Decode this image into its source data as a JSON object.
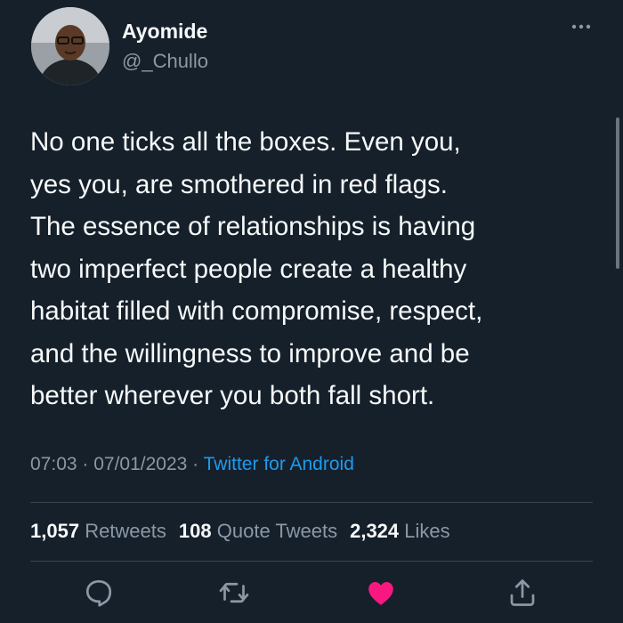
{
  "author": {
    "name": "Ayomide",
    "handle": "@_Chullo"
  },
  "tweet": {
    "text": "No one ticks all the boxes. Even you,\nyes you, are smothered in red flags.\nThe essence of relationships is having\ntwo imperfect people create a healthy\nhabitat filled with compromise, respect,\nand the willingness to improve and be\nbetter wherever you both fall short."
  },
  "meta": {
    "time": "07:03",
    "date": "07/01/2023",
    "separator": " · ",
    "source": "Twitter for Android"
  },
  "stats": {
    "retweets_count": "1,057",
    "retweets_label": "Retweets",
    "quotes_count": "108",
    "quotes_label": "Quote Tweets",
    "likes_count": "2,324",
    "likes_label": "Likes"
  },
  "actions": {
    "reply_icon": "reply-icon",
    "retweet_icon": "retweet-icon",
    "like_icon": "heart-icon",
    "share_icon": "share-icon",
    "like_active": true
  },
  "colors": {
    "background": "#15202b",
    "text": "#f7f9f9",
    "secondary_text": "#8b98a5",
    "link": "#1d9bf0",
    "like": "#f91880",
    "divider": "#38444d"
  }
}
